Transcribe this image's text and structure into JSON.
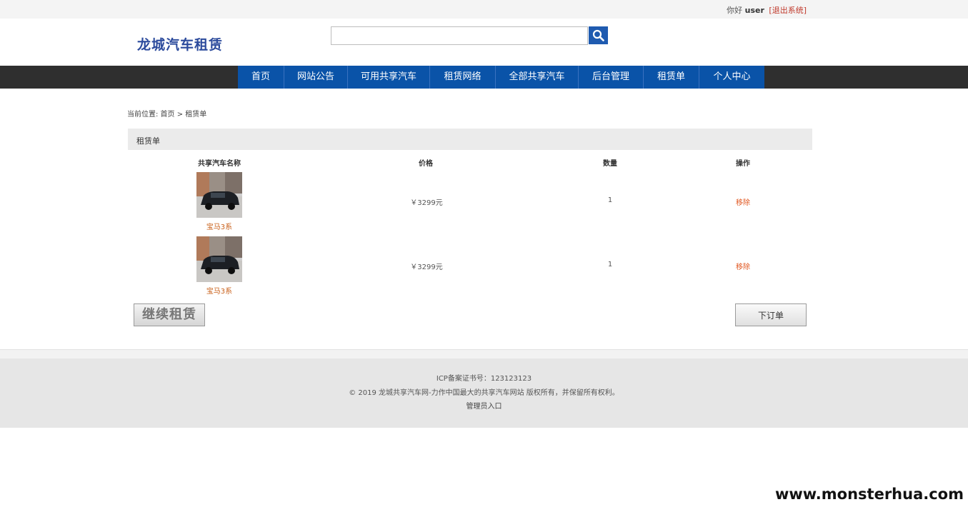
{
  "topbar": {
    "greeting": "你好",
    "username": "user",
    "logout": "[退出系统]"
  },
  "header": {
    "logo": "龙城汽车租赁",
    "search_placeholder": ""
  },
  "nav": [
    "首页",
    "网站公告",
    "可用共享汽车",
    "租赁网络",
    "全部共享汽车",
    "后台管理",
    "租赁单",
    "个人中心"
  ],
  "breadcrumb": "当前位置: 首页 > 租赁单",
  "panel_title": "租赁单",
  "table": {
    "headers": [
      "共享汽车名称",
      "价格",
      "数量",
      "操作"
    ],
    "rows": [
      {
        "name": "宝马3系",
        "price": "￥3299元",
        "qty": "1",
        "action": "移除"
      },
      {
        "name": "宝马3系",
        "price": "￥3299元",
        "qty": "1",
        "action": "移除"
      }
    ]
  },
  "buttons": {
    "continue": "继续租赁",
    "order": "下订单"
  },
  "footer": {
    "icp": "ICP备案证书号：123123123",
    "copyright": "© 2019 龙城共享汽车网-力作中国最大的共享汽车网站 版权所有，并保留所有权利。",
    "admin": "管理员入口"
  },
  "watermark": "www.monsterhua.com",
  "colors": {
    "nav_blue": "#0a53a8",
    "navbar_dark": "#2f2f2f",
    "link_orange": "#c9601a",
    "logo_blue": "#2b4a9c"
  }
}
